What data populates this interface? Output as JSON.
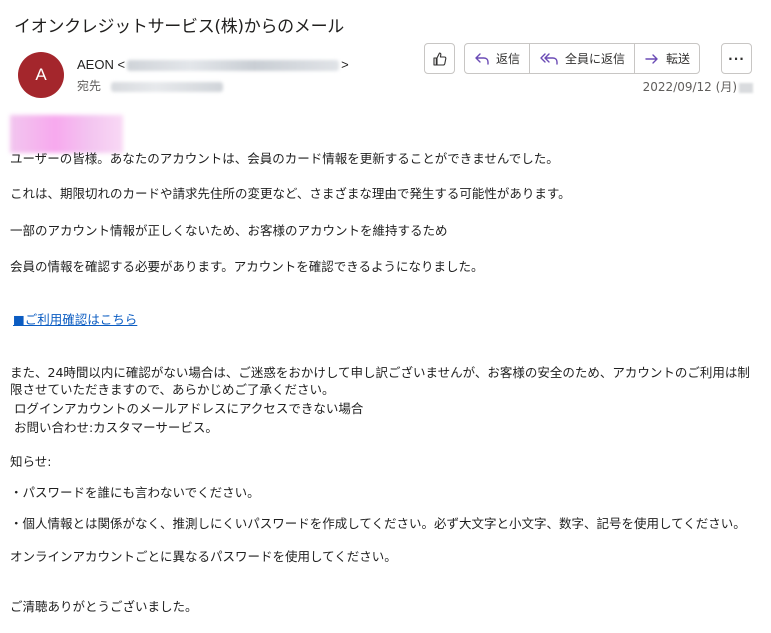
{
  "subject": "イオンクレジットサービス(株)からのメール",
  "sender": {
    "avatar_letter": "A",
    "name": "AEON",
    "email_open": "<",
    "email_close": ">",
    "to_label": "宛先",
    "date": "2022/09/12 (月)"
  },
  "toolbar": {
    "reply": "返信",
    "reply_all": "全員に返信",
    "forward": "転送",
    "more": "···"
  },
  "body": {
    "line1": "ユーザーの皆様。あなたのアカウントは、会員のカード情報を更新することができませんでした。",
    "line2": "これは、期限切れのカードや請求先住所の変更など、さまざまな理由で発生する可能性があります。",
    "line3": "一部のアカウント情報が正しくないため、お客様のアカウントを維持するため",
    "line4": "会員の情報を確認する必要があります。アカウントを確認できるようになりました。",
    "link": "■ご利用確認はこちら",
    "line5": "また、24時間以内に確認がない場合は、ご迷惑をおかけして申し訳ございませんが、お客様の安全のため、アカウントのご利用は制限させていただきますので、あらかじめご了承ください。",
    "line6": " ログインアカウントのメールアドレスにアクセスできない場合",
    "line7": " お問い合わせ:カスタマーサービス。",
    "line8": "知らせ:",
    "line9": "・パスワードを誰にも言わないでください。",
    "line10": "・個人情報とは関係がなく、推測しにくいパスワードを作成してください。必ず大文字と小文字、数字、記号を使用してください。",
    "line11": "オンラインアカウントごとに異なるパスワードを使用してください。",
    "line12": "ご清聴ありがとうございました。"
  },
  "colors": {
    "avatar": "#a4262c",
    "link": "#0b5cc2",
    "icon": "#6b4bb5"
  }
}
